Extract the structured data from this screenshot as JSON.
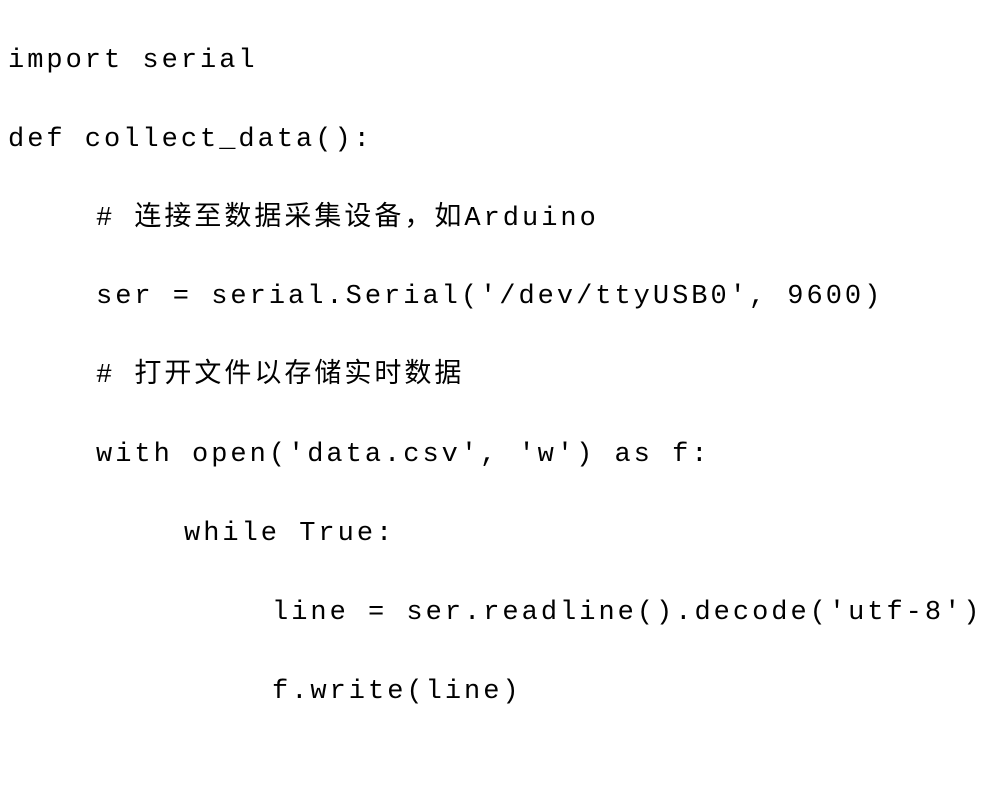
{
  "code": {
    "lines": [
      {
        "indent": 0,
        "text": "import serial"
      },
      {
        "indent": 0,
        "text": ""
      },
      {
        "indent": 0,
        "text": "def collect_data():"
      },
      {
        "indent": 1,
        "text": "# 连接至数据采集设备，如Arduino"
      },
      {
        "indent": 1,
        "text": "ser = serial.Serial('/dev/ttyUSB0', 9600)"
      },
      {
        "indent": 1,
        "text": "# 打开文件以存储实时数据"
      },
      {
        "indent": 1,
        "text": "with open('data.csv', 'w') as f:"
      },
      {
        "indent": 2,
        "text": "while True:"
      },
      {
        "indent": 3,
        "text": "line = ser.readline().decode('utf-8')"
      },
      {
        "indent": 3,
        "text": "f.write(line)"
      }
    ]
  }
}
